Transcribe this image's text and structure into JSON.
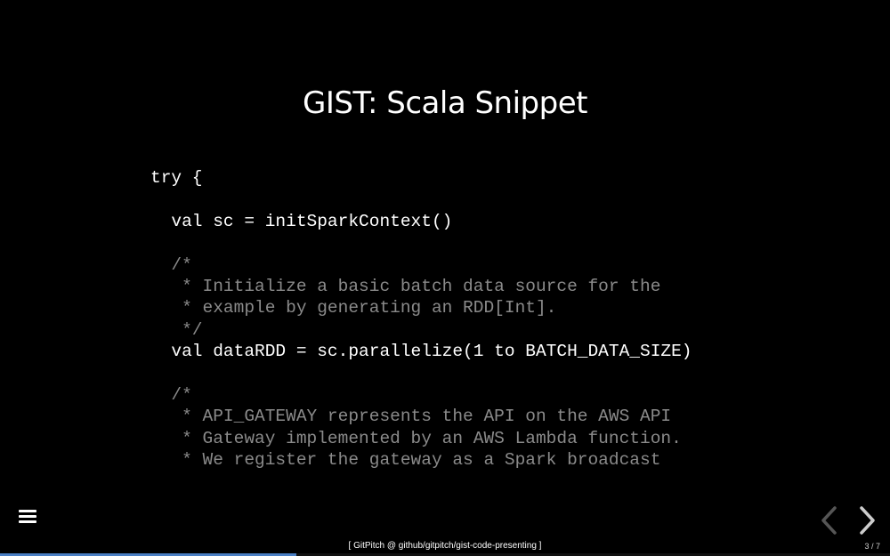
{
  "slide": {
    "title": "GIST: Scala Snippet",
    "code_lines": [
      {
        "text": "try {",
        "kind": "code"
      },
      {
        "text": "",
        "kind": "code"
      },
      {
        "text": "  val sc = initSparkContext()",
        "kind": "code"
      },
      {
        "text": "",
        "kind": "code"
      },
      {
        "text": "  /*",
        "kind": "comment"
      },
      {
        "text": "   * Initialize a basic batch data source for the",
        "kind": "comment"
      },
      {
        "text": "   * example by generating an RDD[Int].",
        "kind": "comment"
      },
      {
        "text": "   */",
        "kind": "comment"
      },
      {
        "text": "  val dataRDD = sc.parallelize(1 to BATCH_DATA_SIZE)",
        "kind": "code"
      },
      {
        "text": "",
        "kind": "code"
      },
      {
        "text": "  /*",
        "kind": "comment"
      },
      {
        "text": "   * API_GATEWAY represents the API on the AWS API",
        "kind": "comment"
      },
      {
        "text": "   * Gateway implemented by an AWS Lambda function.",
        "kind": "comment"
      },
      {
        "text": "   * We register the gateway as a Spark broadcast",
        "kind": "comment"
      }
    ]
  },
  "footer": {
    "attribution": "[ GitPitch @ github/gitpitch/gist-code-presenting ]",
    "slide_number": "3 / 7"
  },
  "progress": {
    "current_slide": 3,
    "total_slides": 7,
    "fraction": 0.333
  },
  "icons": {
    "menu": "hamburger-menu-icon",
    "prev": "chevron-left-icon",
    "next": "chevron-right-icon"
  },
  "colors": {
    "background": "#000000",
    "code": "#ffffff",
    "comment": "#8a8a8a",
    "progress": "#4a7fc4",
    "nav_disabled": "#555555",
    "nav_enabled": "#cccccc"
  }
}
